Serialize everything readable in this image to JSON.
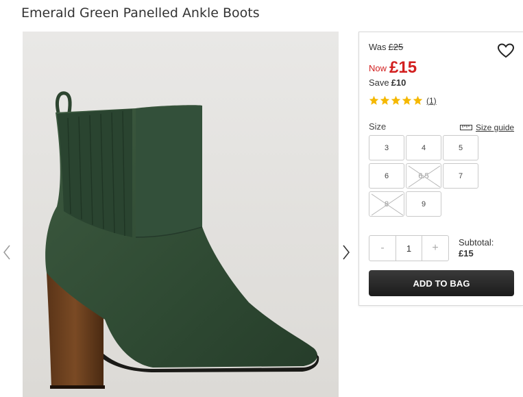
{
  "product": {
    "title": "Emerald Green Panelled Ankle Boots"
  },
  "pricing": {
    "was_label": "Was",
    "was_price": "£25",
    "now_label": "Now",
    "now_price": "£15",
    "save_label": "Save",
    "save_amount": "£10",
    "accent_red": "#d21f1f"
  },
  "rating": {
    "stars": 5,
    "max_stars": 5,
    "review_count": "(1)",
    "star_color": "#f5b800"
  },
  "size": {
    "label": "Size",
    "guide_label": "Size guide",
    "options": [
      {
        "label": "3",
        "available": true
      },
      {
        "label": "4",
        "available": true
      },
      {
        "label": "5",
        "available": true
      },
      {
        "label": "6",
        "available": true
      },
      {
        "label": "6.5",
        "available": false
      },
      {
        "label": "7",
        "available": true
      },
      {
        "label": "8",
        "available": false
      },
      {
        "label": "9",
        "available": true
      }
    ]
  },
  "quantity": {
    "minus": "-",
    "value": "1",
    "plus": "+"
  },
  "subtotal": {
    "label": "Subtotal:",
    "amount": "£15"
  },
  "cart": {
    "add_label": "ADD TO BAG"
  },
  "icons": {
    "wishlist": "heart-icon",
    "prev": "chevron-left-icon",
    "next": "chevron-right-icon",
    "size_guide": "ruler-icon",
    "rating": "star-icon"
  }
}
